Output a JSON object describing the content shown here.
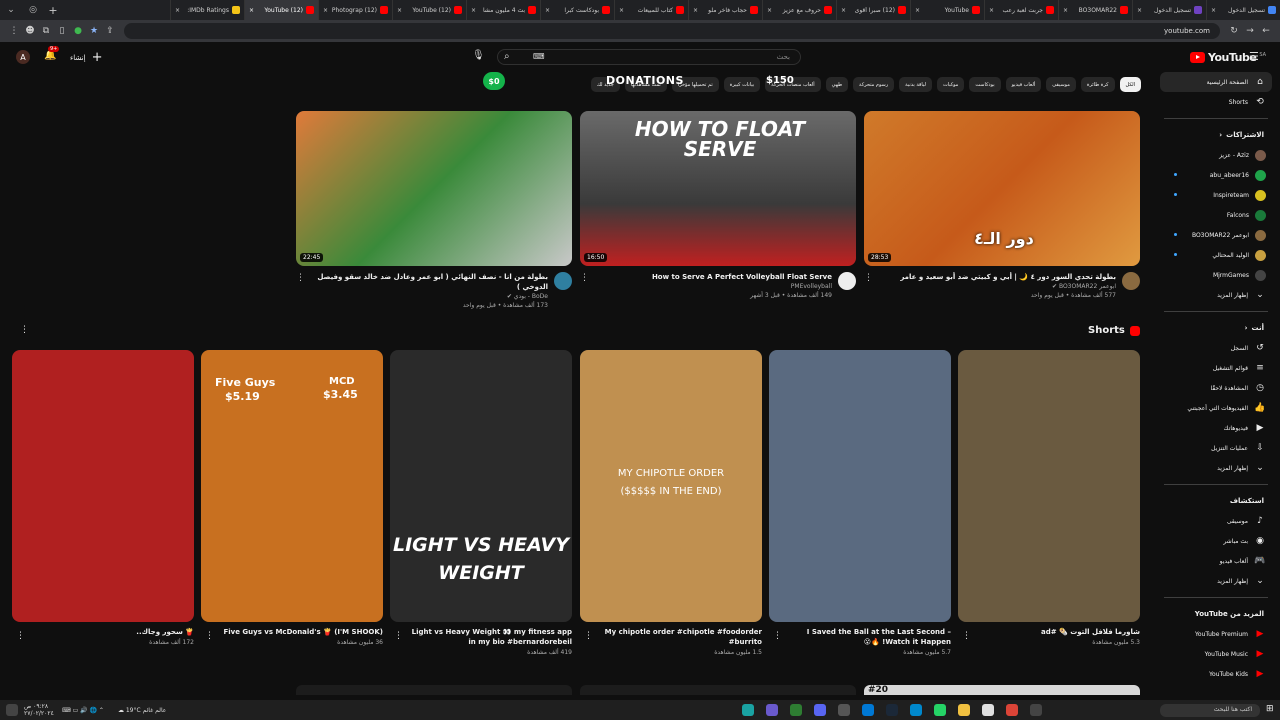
{
  "browser": {
    "tabs": [
      {
        "label": "تسجيل الدخول",
        "color": "#4285f4"
      },
      {
        "label": "تسجيل الدخول",
        "color": "#6f42c1"
      },
      {
        "label": "BO3OMAR22",
        "color": "#ff0000"
      },
      {
        "label": "جربت لعبة رعب",
        "color": "#ff0000"
      },
      {
        "label": "YouTube",
        "color": "#ff0000"
      },
      {
        "label": "(12) صبرا أقوى",
        "color": "#ff0000"
      },
      {
        "label": "حروف مع عزيز",
        "color": "#ff0000"
      },
      {
        "label": "حجاب فاخر ملو",
        "color": "#ff0000"
      },
      {
        "label": "كتاب للمبيعات",
        "color": "#ff0000"
      },
      {
        "label": "بودكاست كبرا",
        "color": "#ff0000"
      },
      {
        "label": "بث 4 مليون مشا",
        "color": "#ff0000"
      },
      {
        "label": "(12) YouTube",
        "color": "#ff0000"
      },
      {
        "label": "(12) Photograp",
        "color": "#ff0000"
      },
      {
        "label": "(12) YouTube",
        "color": "#ff0000",
        "active": true
      },
      {
        "label": "IMDb Ratings:",
        "color": "#f5c518"
      }
    ],
    "url": "youtube.com"
  },
  "header": {
    "avatar_letter": "A",
    "notif_badge": "9+",
    "create_label": "إنشاء",
    "search_placeholder": "بحث",
    "logo": "YouTube",
    "logo_cc": "SA"
  },
  "chips": [
    "الكل",
    "كرة طائرة",
    "موسيقى",
    "ألعاب فيديو",
    "بودكاست",
    "موكبات",
    "لياقة بدنية",
    "رسوم متحركة",
    "طهي",
    "ألعاب منصات الحركة",
    "بيانات كبيرة",
    "تم تحميلها مؤخرًا",
    "تمت مشاهدتها",
    "جديد لك"
  ],
  "donation": {
    "title": "DONATIONS",
    "amount": "$150",
    "zero": "$0"
  },
  "sidebar": {
    "main": [
      {
        "label": "الصفحة الرئيسية",
        "icon": "home-icon",
        "glyph": "⌂",
        "active": true
      },
      {
        "label": "Shorts",
        "icon": "shorts-icon",
        "glyph": "⟲"
      }
    ],
    "subs_title": "الاشتراكات",
    "subs": [
      {
        "label": "Aziz - عزيز",
        "color": "#7a5a4a",
        "dot": false
      },
      {
        "label": "abu_abeer16",
        "color": "#1fa34a",
        "dot": true
      },
      {
        "label": "Inspireteam",
        "color": "#d8c020",
        "dot": true
      },
      {
        "label": "Falcons",
        "color": "#1a7a3a",
        "dot": false
      },
      {
        "label": "ابوعمر BO3OMAR22",
        "color": "#8a6a40",
        "dot": true
      },
      {
        "label": "الوليد المحتالي",
        "color": "#c8a040",
        "dot": true
      },
      {
        "label": "MjrmGames",
        "color": "#444444",
        "dot": false
      }
    ],
    "subs_more": "إظهار المزيد",
    "you_title": "أنت",
    "you": [
      {
        "label": "السجل",
        "icon": "history-icon",
        "glyph": "↺"
      },
      {
        "label": "قوائم التشغيل",
        "icon": "playlist-icon",
        "glyph": "≡"
      },
      {
        "label": "المشاهدة لاحقًا",
        "icon": "watch-later-icon",
        "glyph": "◷"
      },
      {
        "label": "الفيديوهات التي أعجبتني",
        "icon": "like-icon",
        "glyph": "👍"
      },
      {
        "label": "فيديوهاتك",
        "icon": "your-videos-icon",
        "glyph": "▶"
      },
      {
        "label": "عمليات التنزيل",
        "icon": "download-icon",
        "glyph": "⇩"
      },
      {
        "label": "إظهار المزيد",
        "icon": "chevron-down-icon",
        "glyph": "⌄"
      }
    ],
    "explore_title": "استكشاف",
    "explore": [
      {
        "label": "موسيقى",
        "icon": "music-icon",
        "glyph": "♪"
      },
      {
        "label": "بث مباشر",
        "icon": "live-icon",
        "glyph": "◉"
      },
      {
        "label": "ألعاب فيديو",
        "icon": "gaming-icon",
        "glyph": "🎮"
      },
      {
        "label": "إظهار المزيد",
        "icon": "chevron-down-icon",
        "glyph": "⌄"
      }
    ],
    "more_title": "المزيد من YouTube",
    "more": [
      {
        "label": "YouTube Premium",
        "color": "#ff0000"
      },
      {
        "label": "YouTube Music",
        "color": "#ff0000"
      },
      {
        "label": "YouTube Kids",
        "color": "#ff0000"
      }
    ]
  },
  "videos": [
    {
      "title": "بطولة من انا - نصف النهائي ( ابو عمر وعادل ضد خالد سقو وفيصل الدوخي )",
      "channel": "BoDe - بودي ✔",
      "stats": "173 ألف مشاهدة • قبل يوم واحد",
      "duration": "22:45",
      "avcolor": "#2f7fa0"
    },
    {
      "title": "How to Serve A Perfect Volleyball Float Serve",
      "channel": "PMEvolleyball",
      "stats": "149 ألف مشاهدة • قبل 3 أشهر",
      "duration": "16:50",
      "avcolor": "#eeeeee",
      "overlay": "HOW TO FLOAT SERVE"
    },
    {
      "title": "بطولة تحدي السور دور ٤ 🌙 | أبي و كبيتي ضد أبو سعيد و عامر",
      "channel": "ابوعمر BO3OMAR22 ✔",
      "stats": "577 ألف مشاهدة • قبل يوم واحد",
      "duration": "28:53",
      "avcolor": "#8a6a40",
      "overlay": "دور الـ٤"
    }
  ],
  "shorts": {
    "title": "Shorts",
    "items": [
      {
        "title": "🍟 سحور وجاك..",
        "views": "172 ألف مشاهدة",
        "bg": "#b02020"
      },
      {
        "title": "Five Guys vs McDonald's 🍟 (I'M SHOOK)",
        "views": "36 مليون مشاهدة",
        "bg": "#c87020",
        "ov1": "Five Guys",
        "ov2": "$5.19",
        "ov3": "MCD",
        "ov4": "$3.45"
      },
      {
        "title": "Light vs Heavy Weight 👀 my fitness app in my bio #bernardorebeil",
        "views": "419 ألف مشاهدة",
        "bg": "#2a2a2a",
        "ov1": "LIGHT VS HEAVY",
        "ov2": "WEIGHT"
      },
      {
        "title": "My chipotle order #chipotle #foodorder #burrito",
        "views": "1.5 مليون مشاهدة",
        "bg": "#c09050",
        "ov1": "MY CHIPOTLE ORDER",
        "ov2": "($$$$$ IN THE END)"
      },
      {
        "title": "I Saved the Ball at the Last Second – Watch it Happen! 🔥😮",
        "views": "5.7 مليون مشاهدة",
        "bg": "#5a6a80"
      },
      {
        "title": "شاورما فلافل التوت 🌯 #ad",
        "views": "5.3 مليون مشاهدة",
        "bg": "#6a5a40"
      }
    ]
  },
  "taskbar": {
    "weather": "19°C عالم غائم",
    "search": "اكتب هنا للبحث",
    "time": "٠٩:٢٨ ص",
    "date": "٢٧/٠٢/٢٠٢٤"
  },
  "peek": {
    "label": "#20"
  }
}
